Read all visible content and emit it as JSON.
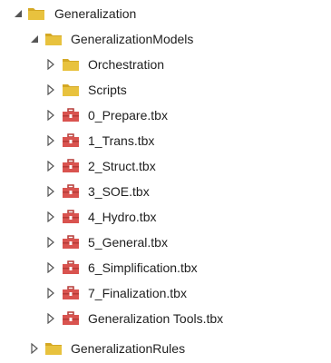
{
  "tree": {
    "root": {
      "label": "Generalization",
      "expanded": true,
      "icon": "folder-icon"
    },
    "models": {
      "label": "GeneralizationModels",
      "expanded": true,
      "icon": "folder-icon"
    },
    "children": [
      {
        "label": "Orchestration",
        "icon": "folder-icon",
        "expanded": false
      },
      {
        "label": "Scripts",
        "icon": "folder-icon",
        "expanded": false
      },
      {
        "label": "0_Prepare.tbx",
        "icon": "toolbox-icon",
        "expanded": false
      },
      {
        "label": "1_Trans.tbx",
        "icon": "toolbox-icon",
        "expanded": false
      },
      {
        "label": "2_Struct.tbx",
        "icon": "toolbox-icon",
        "expanded": false
      },
      {
        "label": "3_SOE.tbx",
        "icon": "toolbox-icon",
        "expanded": false
      },
      {
        "label": "4_Hydro.tbx",
        "icon": "toolbox-icon",
        "expanded": false
      },
      {
        "label": "5_General.tbx",
        "icon": "toolbox-icon",
        "expanded": false
      },
      {
        "label": "6_Simplification.tbx",
        "icon": "toolbox-icon",
        "expanded": false
      },
      {
        "label": "7_Finalization.tbx",
        "icon": "toolbox-icon",
        "expanded": false
      },
      {
        "label": "Generalization Tools.tbx",
        "icon": "toolbox-icon",
        "expanded": false
      }
    ],
    "rules": {
      "label": "GeneralizationRules",
      "expanded": false,
      "icon": "folder-icon"
    }
  },
  "colors": {
    "folder": "#e8c23e",
    "folder_dark": "#d4a824",
    "toolbox": "#d9534f",
    "toolbox_dark": "#b53a36",
    "expander": "#555555"
  }
}
